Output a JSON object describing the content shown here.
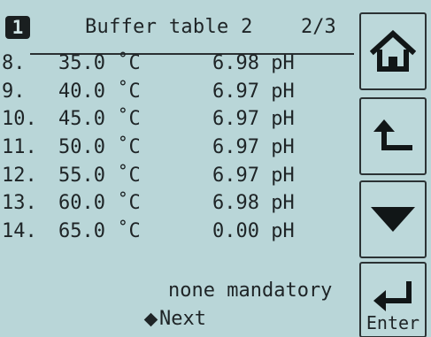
{
  "header": {
    "page_badge": "1",
    "title": "Buffer table 2",
    "pager": "2/3"
  },
  "rows": [
    {
      "index": "8.",
      "temperature": "35.0 ˚C",
      "ph": "6.98 pH"
    },
    {
      "index": "9.",
      "temperature": "40.0 ˚C",
      "ph": "6.97 pH"
    },
    {
      "index": "10.",
      "temperature": "45.0 ˚C",
      "ph": "6.97 pH"
    },
    {
      "index": "11.",
      "temperature": "50.0 ˚C",
      "ph": "6.97 pH"
    },
    {
      "index": "12.",
      "temperature": "55.0 ˚C",
      "ph": "6.97 pH"
    },
    {
      "index": "13.",
      "temperature": "60.0 ˚C",
      "ph": "6.98 pH"
    },
    {
      "index": "14.",
      "temperature": "65.0 ˚C",
      "ph": "0.00 pH"
    }
  ],
  "footer": {
    "note": "none mandatory",
    "next_label": "Next"
  },
  "side_buttons": {
    "home_icon": "home-icon",
    "back_icon": "back-arrow-icon",
    "down_icon": "down-triangle-icon",
    "enter_icon": "enter-icon",
    "enter_label": "Enter"
  },
  "colors": {
    "background": "#b9d6d8",
    "foreground": "#1e2426"
  }
}
